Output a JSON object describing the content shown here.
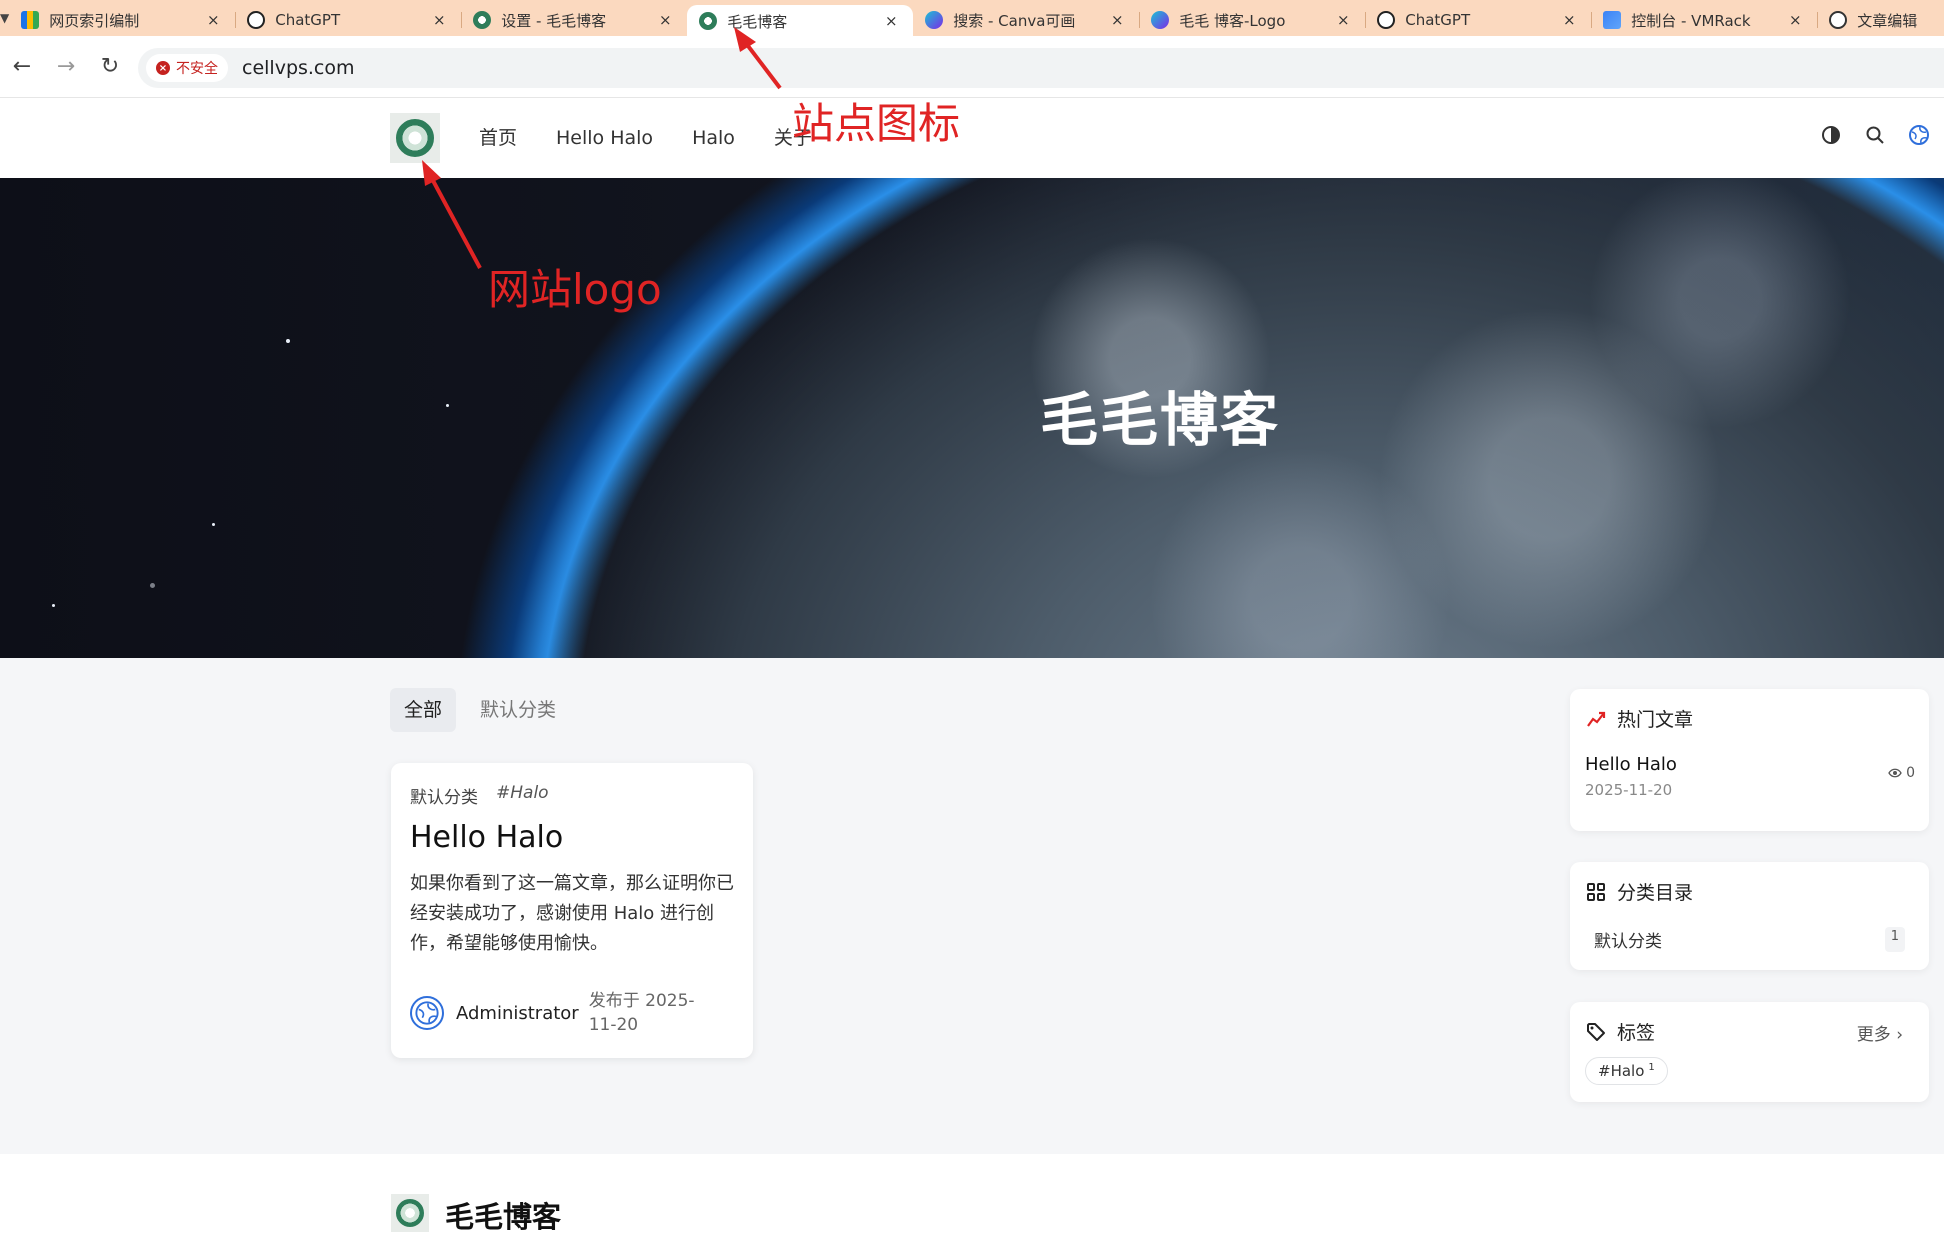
{
  "browser": {
    "tabs": [
      {
        "title": "网页索引编制",
        "icon": "analytics-bars-icon",
        "active": false
      },
      {
        "title": "ChatGPT",
        "icon": "chatgpt-icon",
        "active": false
      },
      {
        "title": "设置 - 毛毛博客",
        "icon": "halo-site-icon",
        "active": false
      },
      {
        "title": "毛毛博客",
        "icon": "halo-site-icon",
        "active": true
      },
      {
        "title": "搜索 - Canva可画",
        "icon": "canva-icon",
        "active": false
      },
      {
        "title": "毛毛 博客-Logo",
        "icon": "canva-icon",
        "active": false
      },
      {
        "title": "ChatGPT",
        "icon": "chatgpt-icon",
        "active": false
      },
      {
        "title": "控制台 - VMRack",
        "icon": "vmrack-icon",
        "active": false
      },
      {
        "title": "文章编辑",
        "icon": "globe-icon",
        "active": false
      }
    ],
    "close_glyph": "×",
    "security_label": "不安全",
    "url": "cellvps.com"
  },
  "site": {
    "nav": [
      "首页",
      "Hello Halo",
      "Halo",
      "关于"
    ],
    "hero_title": "毛毛博客",
    "category_tabs": [
      "全部",
      "默认分类"
    ],
    "post": {
      "category": "默认分类",
      "tag": "#Halo",
      "title": "Hello Halo",
      "excerpt": "如果你看到了这一篇文章，那么证明你已经安装成功了，感谢使用 Halo 进行创作，希望能够使用愉快。",
      "author": "Administrator",
      "published": "发布于 2025-11-20"
    },
    "hot": {
      "heading": "热门文章",
      "title": "Hello Halo",
      "date": "2025-11-20",
      "views": "0"
    },
    "categories": {
      "heading": "分类目录",
      "items": [
        {
          "name": "默认分类",
          "count": "1"
        }
      ]
    },
    "tags": {
      "heading": "标签",
      "more": "更多",
      "items": [
        {
          "name": "#Halo",
          "count": "1"
        }
      ]
    },
    "footer_name": "毛毛博客"
  },
  "annotations": {
    "favicon_label": "站点图标",
    "logo_label": "网站logo",
    "color": "#e02424"
  }
}
